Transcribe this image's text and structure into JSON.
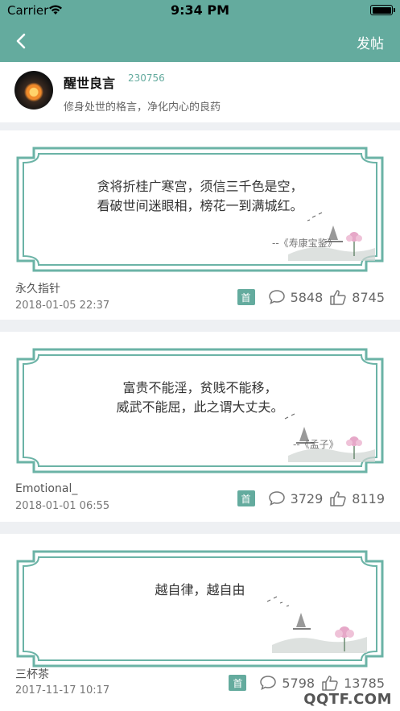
{
  "status_bar": {
    "carrier": "Carrier",
    "time": "9:34 PM"
  },
  "nav": {
    "post_label": "发帖"
  },
  "board": {
    "name": "醒世良言",
    "count": "230756",
    "description": "修身处世的格言，净化内心的良药"
  },
  "posts": [
    {
      "quote_lines": [
        "贪将折桂广寒宫，须信三千色是空，",
        "看破世间迷眼相，榜花一到满城红。"
      ],
      "source": "--《寿康宝鉴》",
      "author": "永久指针",
      "date": "2018-01-05 22:37",
      "badge": "首",
      "comments": "5848",
      "likes": "8745"
    },
    {
      "quote_lines": [
        "富贵不能淫，贫贱不能移，",
        "威武不能屈，此之谓大丈夫。"
      ],
      "source": "--《孟子》",
      "author": "Emotional_",
      "date": "2018-01-01 06:55",
      "badge": "首",
      "comments": "3729",
      "likes": "8119"
    },
    {
      "quote_lines": [
        "越自律，越自由"
      ],
      "source": "",
      "author": "三杯茶",
      "date": "2017-11-17 10:17",
      "badge": "首",
      "comments": "5798",
      "likes": "13785"
    }
  ],
  "watermark": "QQTF.COM",
  "colors": {
    "accent": "#64ab9e",
    "frame": "#6bb3a6"
  }
}
